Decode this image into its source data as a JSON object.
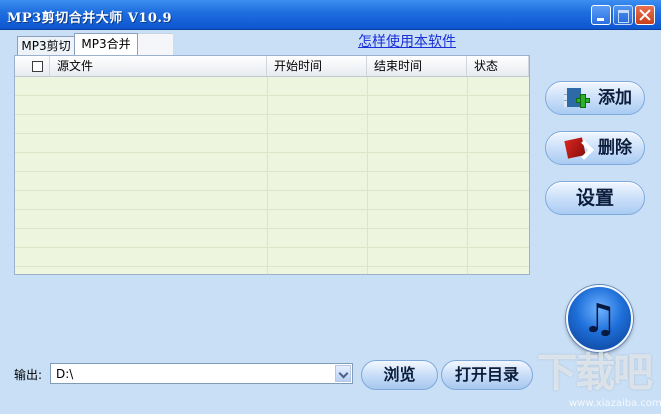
{
  "window": {
    "title": "MP3剪切合并大师 V10.9"
  },
  "tabs": [
    {
      "label": "MP3剪切"
    },
    {
      "label": "MP3合并"
    }
  ],
  "help_link": "怎样使用本软件",
  "table": {
    "columns": [
      "源文件",
      "开始时间",
      "结束时间",
      "状态"
    ],
    "rows": []
  },
  "buttons": {
    "add": "添加",
    "delete": "删除",
    "settings": "设置",
    "browse": "浏览",
    "open_dir": "打开目录"
  },
  "output": {
    "label": "输出:",
    "value": "D:\\"
  },
  "watermark": {
    "text": "下载吧",
    "url": "www.xiazaiba.com"
  },
  "icons": {
    "add": "film-add-icon",
    "delete": "delete-file-icon",
    "music": "music-note-icon"
  }
}
